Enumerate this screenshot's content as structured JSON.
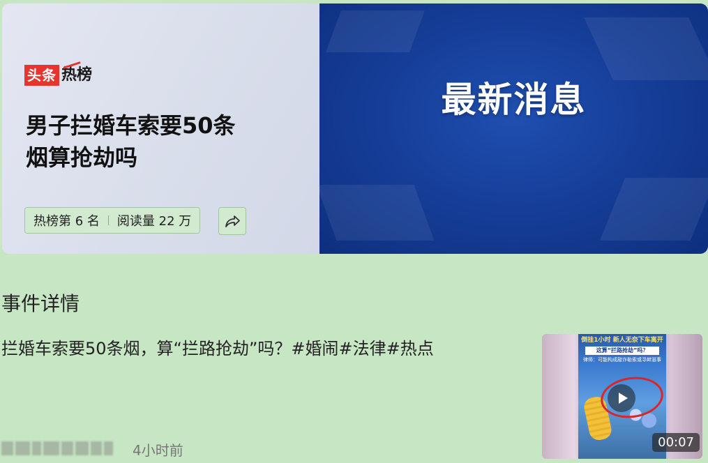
{
  "card": {
    "brand_red": "头条",
    "brand_dark": "热榜",
    "headline_line1": "男子拦婚车索要50条",
    "headline_line2": "烟算抢劫吗",
    "rank_text": "热榜第 6 名",
    "reads_text": "阅读量 22 万",
    "banner_text": "最新消息"
  },
  "post": {
    "section_title": "事件详情",
    "body": "拦婚车索要50条烟，算“拦路抢劫”吗？#婚闹#法律#热点",
    "time": "4小时前"
  },
  "video": {
    "caption_top": "倒挂1小时 新人无奈下车离开",
    "caption_mid": "这算“拦路抢劫”吗？",
    "caption_sub": "律师：可能构成敲诈勒索或寻衅滋事",
    "duration": "00:07"
  },
  "colors": {
    "background": "#c7e6c4",
    "brand_red": "#e8342e",
    "banner_blue": "#163f9a"
  }
}
